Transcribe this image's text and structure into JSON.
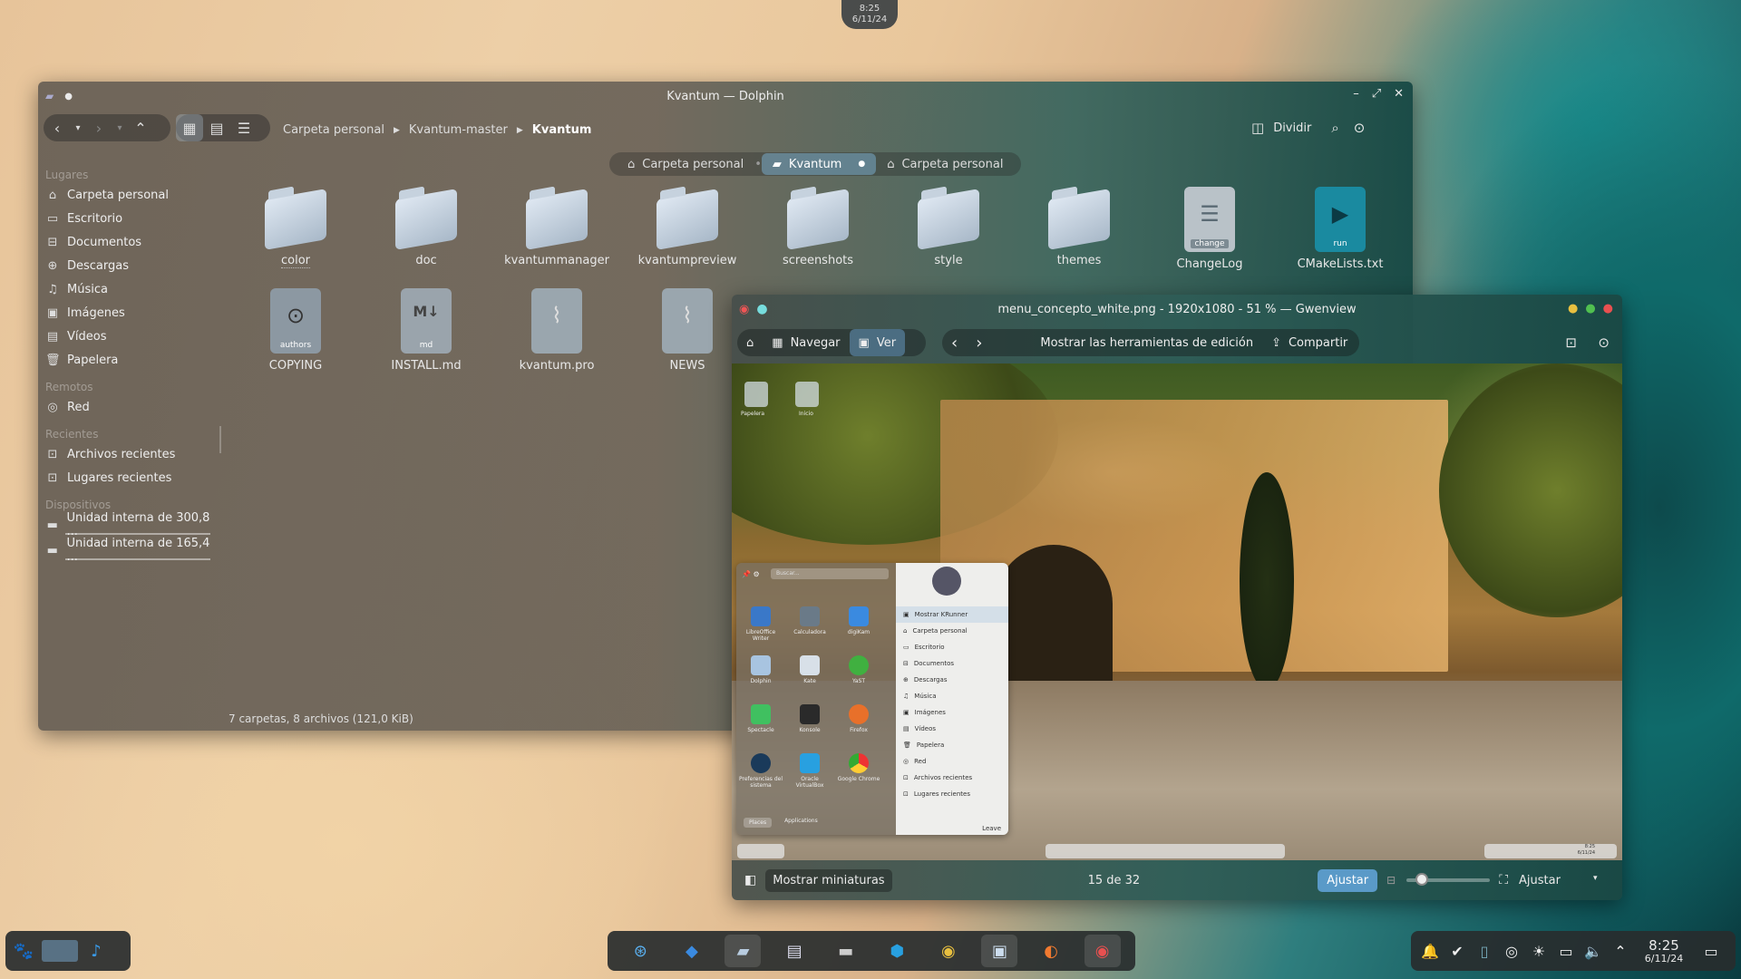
{
  "top_clock": {
    "time": "8:25",
    "date": "6/11/24"
  },
  "dolphin": {
    "title": "Kvantum — Dolphin",
    "breadcrumb": [
      "Carpeta personal",
      "Kvantum-master",
      "Kvantum"
    ],
    "split_label": "Dividir",
    "tabs": [
      "Carpeta personal",
      "Kvantum",
      "Carpeta personal"
    ],
    "sidebar": {
      "places_heading": "Lugares",
      "places": [
        "Carpeta personal",
        "Escritorio",
        "Documentos",
        "Descargas",
        "Música",
        "Imágenes",
        "Vídeos",
        "Papelera"
      ],
      "remote_heading": "Remotos",
      "remote": [
        "Red"
      ],
      "recent_heading": "Recientes",
      "recent": [
        "Archivos recientes",
        "Lugares recientes"
      ],
      "devices_heading": "Dispositivos",
      "devices": [
        "Unidad interna de 300,8 ...",
        "Unidad interna de 165,4 ..."
      ]
    },
    "files_row1": [
      "color",
      "doc",
      "kvantummanager",
      "kvantumpreview",
      "screenshots",
      "style",
      "themes",
      "ChangeLog",
      "CMakeLists.txt"
    ],
    "changelog_badge": "change",
    "cmake_badge": "run",
    "files_row2": [
      "COPYING",
      "INSTALL.md",
      "kvantum.pro",
      "NEWS"
    ],
    "copying_badge": "authors",
    "install_badge": "md",
    "status": "7 carpetas, 8 archivos (121,0 KiB)"
  },
  "gwenview": {
    "title": "menu_concepto_white.png - 1920x1080 - 51 % — Gwenview",
    "navigate_label": "Navegar",
    "view_label": "Ver",
    "edit_tools_label": "Mostrar las herramientas de edición",
    "share_label": "Compartir",
    "thumbnails_label": "Mostrar miniaturas",
    "counter": "15 de 32",
    "fit_label": "Ajustar",
    "zoom_select": "Ajustar",
    "zoom_level": 0.12
  },
  "preview_menu": {
    "apps": [
      [
        "LibreOffice Writer",
        "Calculadora",
        "digiKam"
      ],
      [
        "Dolphin",
        "Kate",
        "YaST"
      ],
      [
        "Spectacle",
        "Konsole",
        "Firefox"
      ],
      [
        "Preferencias del sistema",
        "Oracle VirtualBox",
        "Google Chrome"
      ]
    ],
    "places": [
      "Mostrar KRunner",
      "Carpeta personal",
      "Escritorio",
      "Documentos",
      "Descargas",
      "Música",
      "Imágenes",
      "Vídeos",
      "Papelera",
      "Red",
      "Archivos recientes",
      "Lugares recientes"
    ],
    "search_placeholder": "Buscar...",
    "tab_places": "Places",
    "tab_apps": "Applications",
    "leave": "Leave",
    "desktop_icons": [
      "Papelera",
      "Inicio"
    ],
    "clock": {
      "time": "8:25",
      "date": "6/11/24"
    }
  },
  "taskbar": {
    "time": "8:25",
    "date": "6/11/24"
  },
  "colors": {
    "accent": "#5a9ac8",
    "close": "#e85050",
    "minimize": "#e8c040",
    "maximize": "#50c050"
  }
}
